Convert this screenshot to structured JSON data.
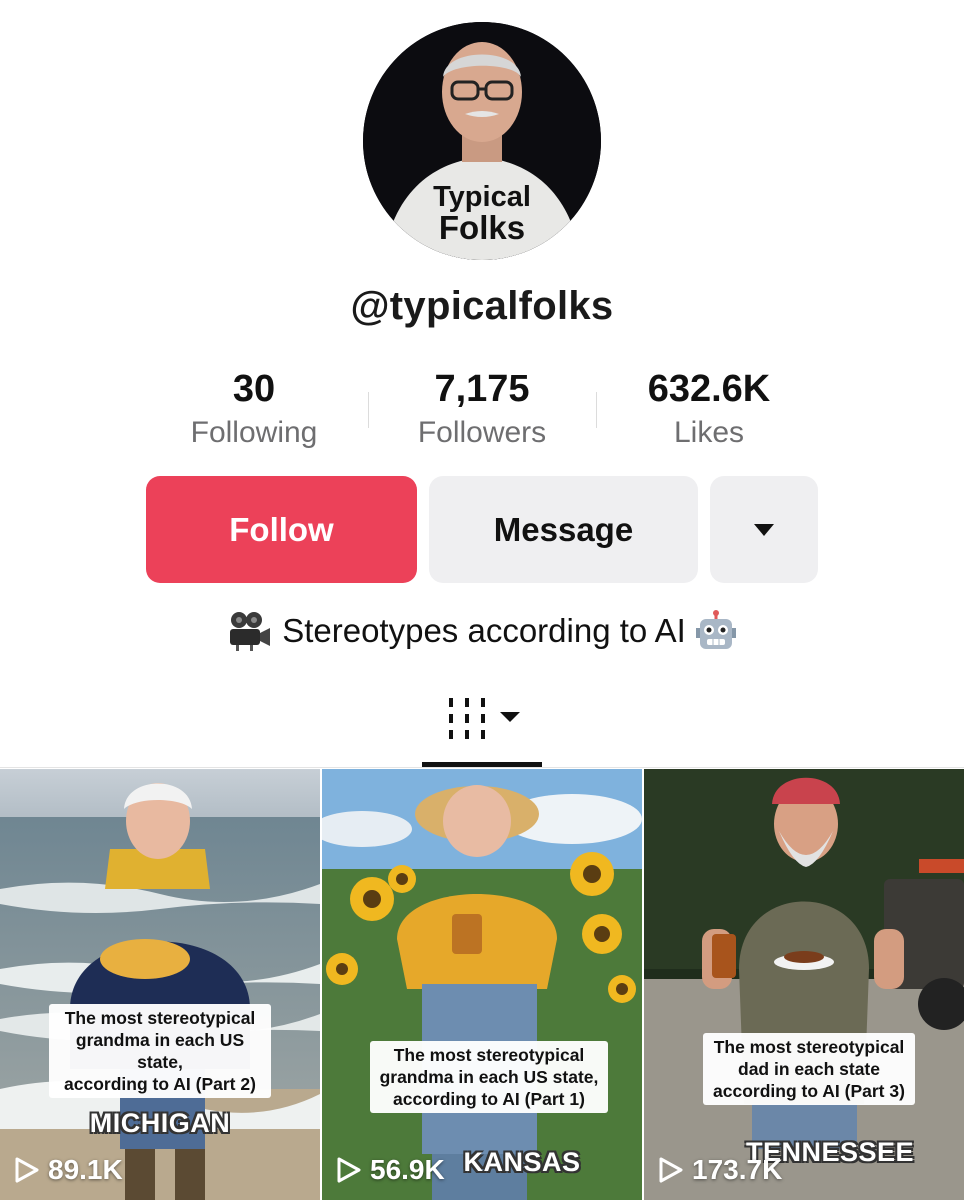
{
  "profile": {
    "username": "@typicalfolks",
    "avatar_text_line1": "Typical",
    "avatar_text_line2": "Folks",
    "bio_text": "Stereotypes according to AI",
    "bio_leading_icon": "movie-camera-icon",
    "bio_trailing_icon": "robot-face-icon"
  },
  "stats": [
    {
      "value": "30",
      "label": "Following"
    },
    {
      "value": "7,175",
      "label": "Followers"
    },
    {
      "value": "632.6K",
      "label": "Likes"
    }
  ],
  "actions": {
    "follow_label": "Follow",
    "message_label": "Message",
    "more_icon": "caret-down-icon"
  },
  "tabs": {
    "active_icon": "grid-icon"
  },
  "colors": {
    "follow_accent": "#ec4159",
    "secondary_button": "#efeff1",
    "muted_text": "#6e6e70"
  },
  "videos": [
    {
      "caption_lines": [
        "The most stereotypical",
        "grandma in each US state,",
        "according to AI (Part 2)"
      ],
      "state": "MICHIGAN",
      "views": "89.1K"
    },
    {
      "caption_lines": [
        "The most stereotypical",
        "grandma in each US state,",
        "according to AI (Part 1)"
      ],
      "state": "KANSAS",
      "views": "56.9K"
    },
    {
      "caption_lines": [
        "The most stereotypical",
        "dad in each state",
        "according to AI (Part 3)"
      ],
      "state": "TENNESSEE",
      "views": "173.7K"
    }
  ]
}
